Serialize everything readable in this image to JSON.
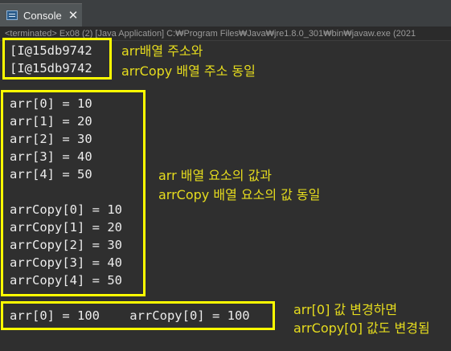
{
  "tab": {
    "label": "Console",
    "icon": "console-icon",
    "close": "✕"
  },
  "status_line": "<terminated> Ex08 (2) [Java Application] C:₩Program Files₩Java₩jre1.8.0_301₩bin₩javaw.exe  (2021",
  "output": {
    "address_lines": [
      "[I@15db9742",
      "[I@15db9742"
    ],
    "arr_lines": [
      "arr[0] = 10",
      "arr[1] = 20",
      "arr[2] = 30",
      "arr[3] = 40",
      "arr[4] = 50"
    ],
    "copy_lines": [
      "arrCopy[0] = 10",
      "arrCopy[1] = 20",
      "arrCopy[2] = 30",
      "arrCopy[3] = 40",
      "arrCopy[4] = 50"
    ],
    "changed_line": "arr[0] = 100    arrCopy[0] = 100"
  },
  "notes": {
    "address_1": "arr배열 주소와",
    "address_2": "arrCopy 배열 주소 동일",
    "values_1": "arr 배열 요소의 값과",
    "values_2": "arrCopy 배열 요소의 값 동일",
    "change_1": "arr[0] 값 변경하면",
    "change_2": "arrCopy[0] 값도 변경됨"
  },
  "colors": {
    "highlight": "#ffff00",
    "note_text": "#e6dc1e",
    "console_bg": "#2f2f2f"
  }
}
